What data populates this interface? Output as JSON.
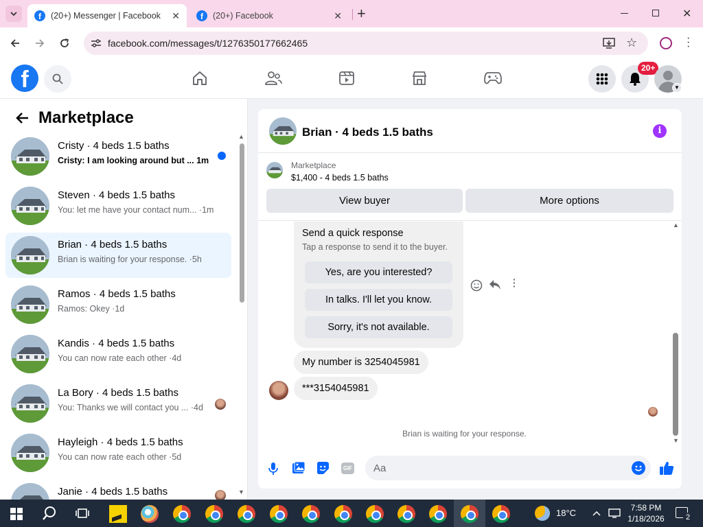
{
  "browser": {
    "tabs": [
      {
        "title": "(20+) Messenger | Facebook",
        "active": true
      },
      {
        "title": "(20+) Facebook",
        "active": false
      }
    ],
    "url": "facebook.com/messages/t/1276350177662465"
  },
  "fb": {
    "notif_badge": "20+",
    "brand_color": "#1877f2"
  },
  "sidebar": {
    "title": "Marketplace",
    "conversations": [
      {
        "title": "Cristy · 4 beds 1.5 baths",
        "preview": "Cristy: I am looking around but ... ",
        "time": "1m",
        "unread": true
      },
      {
        "title": "Steven · 4 beds 1.5 baths",
        "preview": "You: let me have your contact num... ",
        "time": "·1m",
        "unread": false
      },
      {
        "title": "Brian · 4 beds 1.5 baths",
        "preview": "Brian is waiting for your response. ",
        "time": "·5h",
        "unread": false,
        "selected": true
      },
      {
        "title": "Ramos · 4 beds 1.5 baths",
        "preview": "Ramos: Okey ",
        "time": "·1d",
        "unread": false
      },
      {
        "title": "Kandis · 4 beds 1.5 baths",
        "preview": "You can now rate each other ",
        "time": "·4d",
        "unread": false
      },
      {
        "title": "La Bory · 4 beds 1.5 baths",
        "preview": "You: Thanks we will contact you ... ",
        "time": "·4d",
        "unread": false
      },
      {
        "title": "Hayleigh · 4 beds 1.5 baths",
        "preview": "You can now rate each other ",
        "time": "·5d",
        "unread": false
      },
      {
        "title": "Janie · 4 beds 1.5 baths",
        "preview": "",
        "time": "",
        "unread": false
      }
    ]
  },
  "chat": {
    "title": "Brian · 4 beds 1.5 baths",
    "listing_source": "Marketplace",
    "listing": "$1,400 - 4 beds 1.5 baths",
    "view_buyer": "View buyer",
    "more_options": "More options",
    "quick_response": {
      "title": "Send a quick response",
      "subtitle": "Tap a response to send it to the buyer.",
      "options": [
        "Yes, are you interested?",
        "In talks. I'll let you know.",
        "Sorry, it's not available."
      ]
    },
    "messages": [
      {
        "text": "My number is 3254045981"
      },
      {
        "text": "***3154045981"
      }
    ],
    "status": "Brian is waiting for your response.",
    "input_placeholder": "Aa",
    "gif_label": "GIF"
  },
  "taskbar": {
    "weather": "18°C",
    "time": "7:58 PM",
    "date": "1/18/2026",
    "notif_count": "2"
  }
}
